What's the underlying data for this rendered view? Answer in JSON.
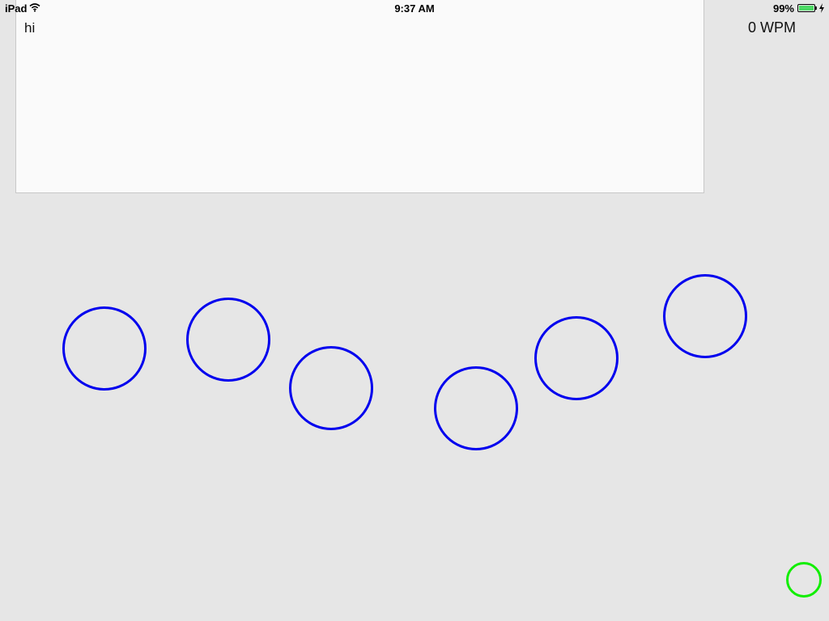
{
  "status_bar": {
    "device": "iPad",
    "time": "9:37 AM",
    "battery_percent": "99%",
    "battery_color": "#4cd964"
  },
  "text_panel": {
    "content": "hi"
  },
  "wpm": {
    "label": "0 WPM"
  },
  "targets": {
    "count": 6,
    "color": "#0000ee"
  },
  "indicator": {
    "color": "#11ee00"
  }
}
